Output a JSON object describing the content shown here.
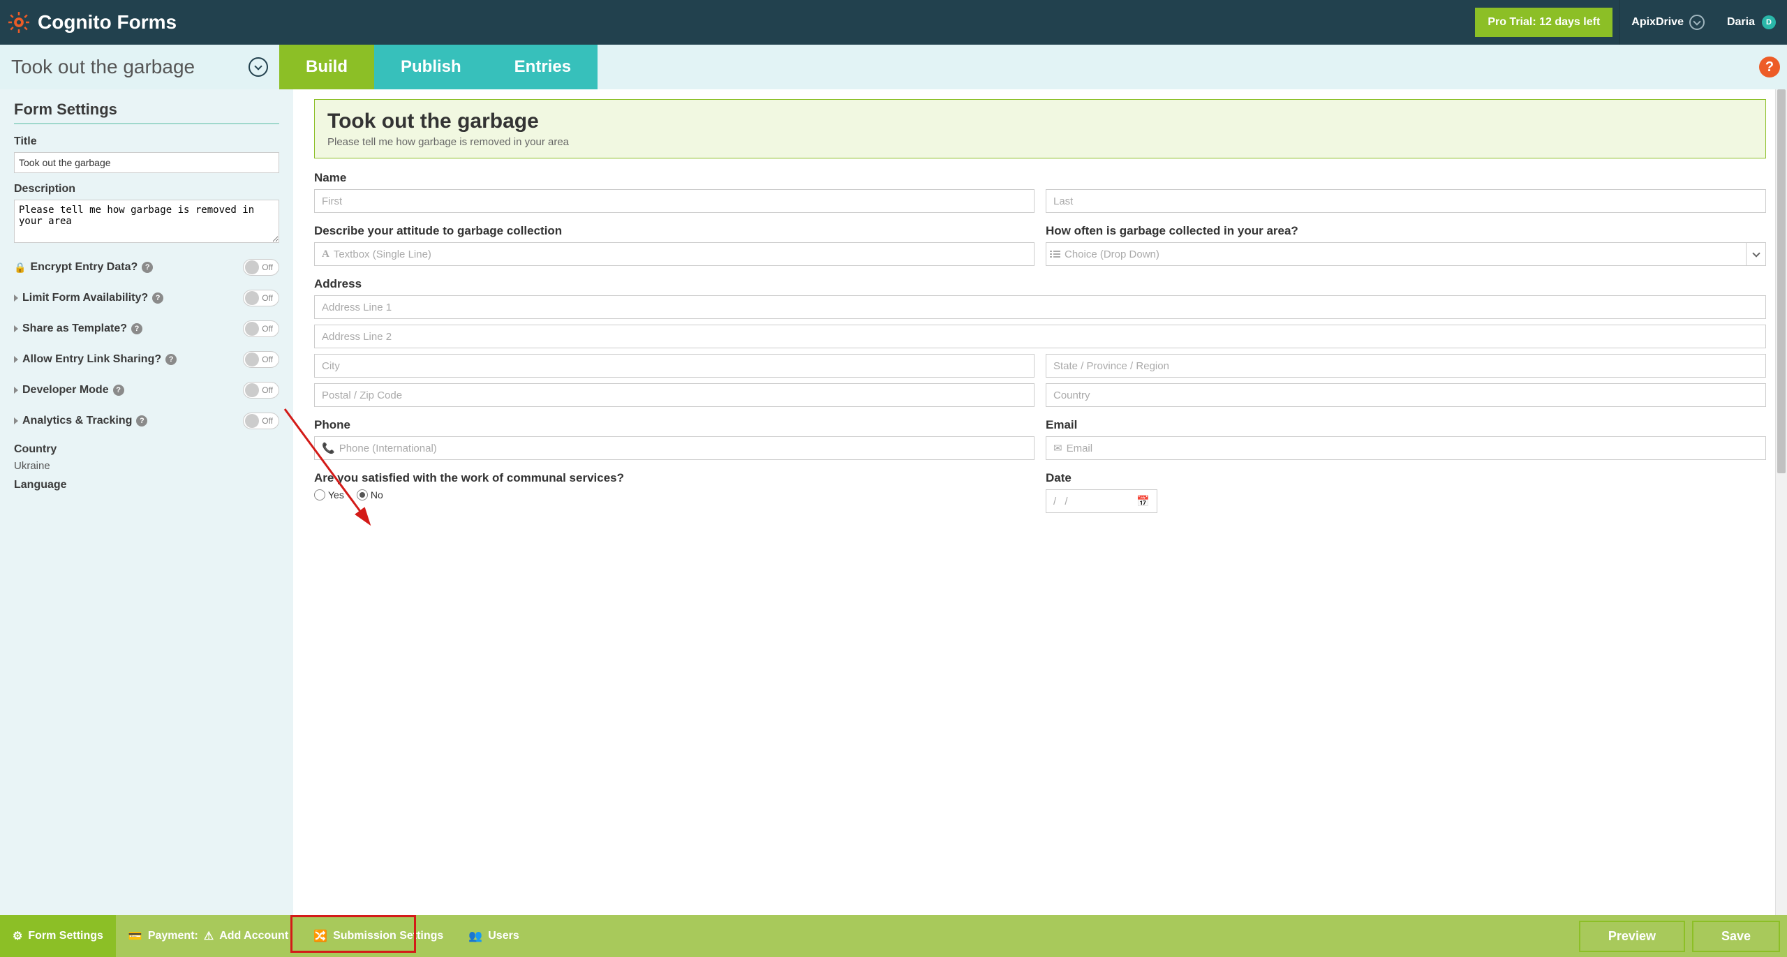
{
  "brand": "Cognito Forms",
  "trial_badge": "Pro Trial: 12 days left",
  "org_name": "ApixDrive",
  "user_name": "Daria",
  "user_initial": "D",
  "form_name": "Took out the garbage",
  "tabs": {
    "build": "Build",
    "publish": "Publish",
    "entries": "Entries"
  },
  "help_label": "?",
  "sidebar": {
    "title": "Form Settings",
    "title_label": "Title",
    "title_value": "Took out the garbage",
    "desc_label": "Description",
    "desc_value": "Please tell me how garbage is removed in your area",
    "toggles": {
      "encrypt": "Encrypt Entry Data?",
      "limit": "Limit Form Availability?",
      "share": "Share as Template?",
      "link": "Allow Entry Link Sharing?",
      "dev": "Developer Mode",
      "analytics": "Analytics & Tracking"
    },
    "toggle_off": "Off",
    "country_label": "Country",
    "country_value": "Ukraine",
    "language_label": "Language"
  },
  "canvas": {
    "form_title": "Took out the garbage",
    "form_desc": "Please tell me how garbage is removed in your area",
    "labels": {
      "name": "Name",
      "first": "First",
      "last": "Last",
      "attitude": "Describe your attitude to garbage collection",
      "textbox_ph": "Textbox (Single Line)",
      "how_often": "How often is garbage collected in your area?",
      "choice_ph": "Choice (Drop Down)",
      "address": "Address",
      "addr1": "Address Line 1",
      "addr2": "Address Line 2",
      "city": "City",
      "state": "State / Province / Region",
      "postal": "Postal / Zip Code",
      "country": "Country",
      "phone": "Phone",
      "phone_ph": "Phone (International)",
      "email": "Email",
      "email_ph": "Email",
      "satisfied": "Are you satisfied with the work of communal services?",
      "yes": "Yes",
      "no": "No",
      "date": "Date",
      "date_ph": "/    /"
    }
  },
  "bottombar": {
    "form_settings": "Form Settings",
    "payment": "Payment:",
    "add_account": "Add Account",
    "submission": "Submission Settings",
    "users": "Users",
    "preview": "Preview",
    "save": "Save"
  }
}
